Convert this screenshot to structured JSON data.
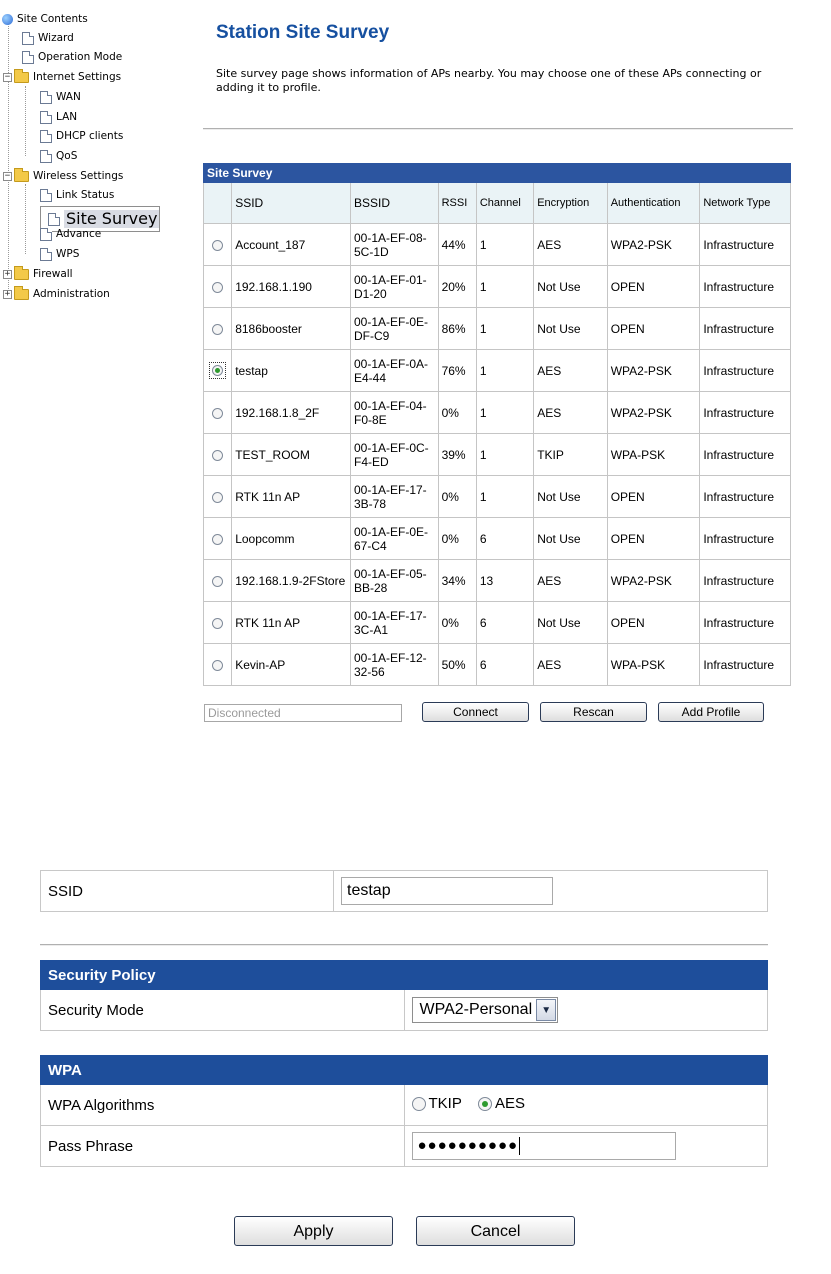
{
  "tree": {
    "root": "Site Contents",
    "items": [
      {
        "label": "Wizard"
      },
      {
        "label": "Operation Mode"
      },
      {
        "label": "Internet Settings",
        "children": [
          "WAN",
          "LAN",
          "DHCP clients",
          "QoS"
        ]
      },
      {
        "label": "Wireless Settings",
        "children": [
          "Link Status",
          "Site Survey",
          "Advance",
          "WPS"
        ]
      },
      {
        "label": "Firewall"
      },
      {
        "label": "Administration"
      }
    ],
    "selected": "Site Survey"
  },
  "page": {
    "title": "Station Site Survey",
    "intro": "Site survey page shows information of APs nearby. You may choose one of these APs connecting or adding it to profile."
  },
  "survey": {
    "caption": "Site Survey",
    "headers": [
      "",
      "SSID",
      "BSSID",
      "RSSI",
      "Channel",
      "Encryption",
      "Authentication",
      "Network Type"
    ],
    "rows": [
      {
        "ssid": "Account_187",
        "bssid": "00-1A-EF-08-5C-1D",
        "rssi": "44%",
        "channel": "1",
        "encryption": "AES",
        "auth": "WPA2-PSK",
        "type": "Infrastructure",
        "selected": false
      },
      {
        "ssid": "192.168.1.190",
        "bssid": "00-1A-EF-01-D1-20",
        "rssi": "20%",
        "channel": "1",
        "encryption": "Not Use",
        "auth": "OPEN",
        "type": "Infrastructure",
        "selected": false
      },
      {
        "ssid": "8186booster",
        "bssid": "00-1A-EF-0E-DF-C9",
        "rssi": "86%",
        "channel": "1",
        "encryption": "Not Use",
        "auth": "OPEN",
        "type": "Infrastructure",
        "selected": false
      },
      {
        "ssid": "testap",
        "bssid": "00-1A-EF-0A-E4-44",
        "rssi": "76%",
        "channel": "1",
        "encryption": "AES",
        "auth": "WPA2-PSK",
        "type": "Infrastructure",
        "selected": true
      },
      {
        "ssid": "192.168.1.8_2F",
        "bssid": "00-1A-EF-04-F0-8E",
        "rssi": "0%",
        "channel": "1",
        "encryption": "AES",
        "auth": "WPA2-PSK",
        "type": "Infrastructure",
        "selected": false
      },
      {
        "ssid": "TEST_ROOM",
        "bssid": "00-1A-EF-0C-F4-ED",
        "rssi": "39%",
        "channel": "1",
        "encryption": "TKIP",
        "auth": "WPA-PSK",
        "type": "Infrastructure",
        "selected": false
      },
      {
        "ssid": "RTK 11n AP",
        "bssid": "00-1A-EF-17-3B-78",
        "rssi": "0%",
        "channel": "1",
        "encryption": "Not Use",
        "auth": "OPEN",
        "type": "Infrastructure",
        "selected": false
      },
      {
        "ssid": "Loopcomm",
        "bssid": "00-1A-EF-0E-67-C4",
        "rssi": "0%",
        "channel": "6",
        "encryption": "Not Use",
        "auth": "OPEN",
        "type": "Infrastructure",
        "selected": false
      },
      {
        "ssid": "192.168.1.9-2FStore",
        "bssid": "00-1A-EF-05-BB-28",
        "rssi": "34%",
        "channel": "13",
        "encryption": "AES",
        "auth": "WPA2-PSK",
        "type": "Infrastructure",
        "selected": false
      },
      {
        "ssid": "RTK 11n AP",
        "bssid": "00-1A-EF-17-3C-A1",
        "rssi": "0%",
        "channel": "6",
        "encryption": "Not Use",
        "auth": "OPEN",
        "type": "Infrastructure",
        "selected": false
      },
      {
        "ssid": "Kevin-AP",
        "bssid": "00-1A-EF-12-32-56",
        "rssi": "50%",
        "channel": "6",
        "encryption": "AES",
        "auth": "WPA-PSK",
        "type": "Infrastructure",
        "selected": false
      }
    ],
    "status": "Disconnected",
    "buttons": {
      "connect": "Connect",
      "rescan": "Rescan",
      "add_profile": "Add Profile"
    }
  },
  "ssid_section": {
    "label": "SSID",
    "value": "testap"
  },
  "security": {
    "band": "Security Policy",
    "mode_label": "Security Mode",
    "mode_value": "WPA2-Personal"
  },
  "wpa": {
    "band": "WPA",
    "algorithms_label": "WPA Algorithms",
    "algorithms": [
      {
        "label": "TKIP",
        "selected": false
      },
      {
        "label": "AES",
        "selected": true
      }
    ],
    "passphrase_label": "Pass Phrase",
    "passphrase_mask": "●●●●●●●●●●"
  },
  "actions": {
    "apply": "Apply",
    "cancel": "Cancel"
  },
  "icons": {
    "root": "globe-icon",
    "page": "document-icon",
    "folder": "folder-icon",
    "expand": "plus-icon",
    "collapse": "minus-icon"
  },
  "colors": {
    "title": "#1650a0",
    "band": "#1e4e9b",
    "survey_caption": "#2c55a0",
    "radio_selected": "#2e9a2e"
  }
}
